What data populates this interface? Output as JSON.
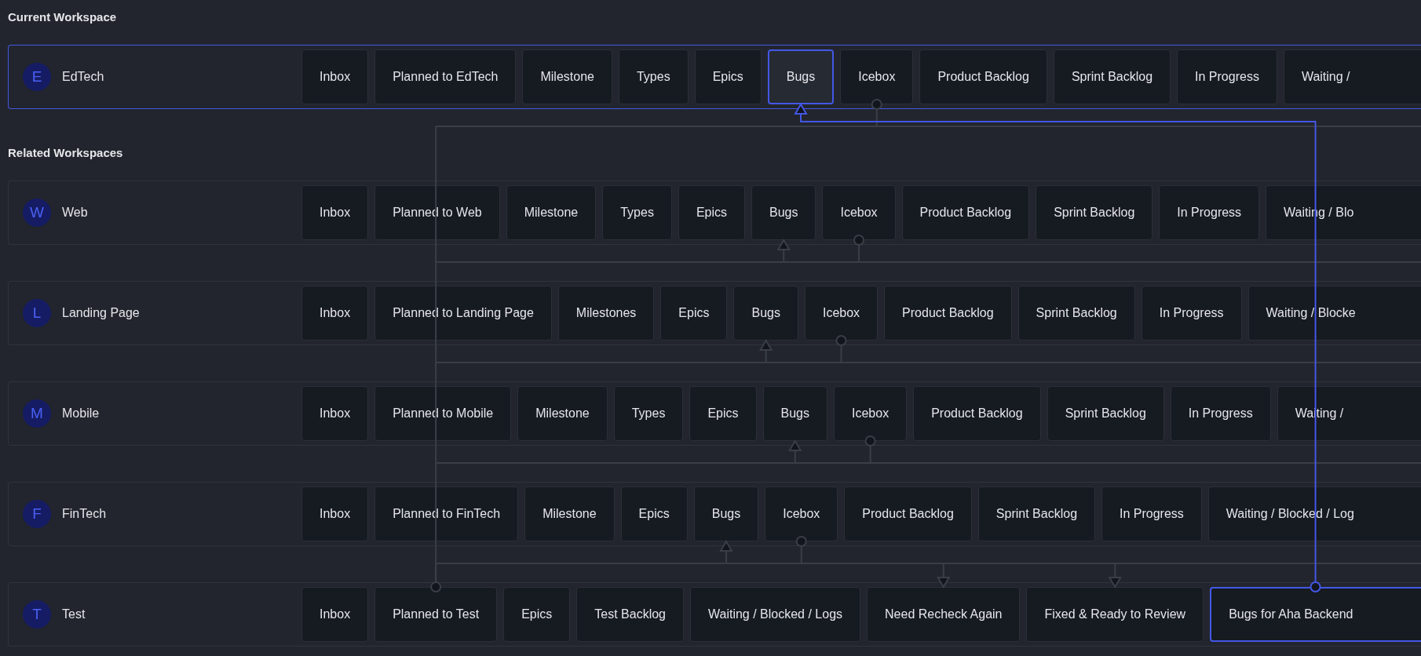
{
  "sections": [
    {
      "title": "Current Workspace",
      "workspaces": [
        {
          "initial": "E",
          "name": "EdTech",
          "selected": true,
          "lanes": [
            {
              "label": "Inbox",
              "selected": false,
              "kind": "plain"
            },
            {
              "label": "Planned to EdTech",
              "selected": false,
              "kind": "plain"
            },
            {
              "label": "Milestone",
              "selected": false,
              "kind": "plain"
            },
            {
              "label": "Types",
              "selected": false,
              "kind": "plain"
            },
            {
              "label": "Epics",
              "selected": false,
              "kind": "plain"
            },
            {
              "label": "Bugs",
              "selected": true,
              "kind": "target"
            },
            {
              "label": "Icebox",
              "selected": false,
              "kind": "source"
            },
            {
              "label": "Product Backlog",
              "selected": false,
              "kind": "plain"
            },
            {
              "label": "Sprint Backlog",
              "selected": false,
              "kind": "plain"
            },
            {
              "label": "In Progress",
              "selected": false,
              "kind": "plain"
            },
            {
              "label": "Waiting /",
              "selected": false,
              "kind": "plain"
            }
          ]
        }
      ]
    },
    {
      "title": "Related Workspaces",
      "workspaces": [
        {
          "initial": "W",
          "name": "Web",
          "selected": false,
          "lanes": [
            {
              "label": "Inbox",
              "selected": false,
              "kind": "plain"
            },
            {
              "label": "Planned to Web",
              "selected": false,
              "kind": "plain"
            },
            {
              "label": "Milestone",
              "selected": false,
              "kind": "plain"
            },
            {
              "label": "Types",
              "selected": false,
              "kind": "plain"
            },
            {
              "label": "Epics",
              "selected": false,
              "kind": "plain"
            },
            {
              "label": "Bugs",
              "selected": false,
              "kind": "target"
            },
            {
              "label": "Icebox",
              "selected": false,
              "kind": "source"
            },
            {
              "label": "Product Backlog",
              "selected": false,
              "kind": "plain"
            },
            {
              "label": "Sprint Backlog",
              "selected": false,
              "kind": "plain"
            },
            {
              "label": "In Progress",
              "selected": false,
              "kind": "plain"
            },
            {
              "label": "Waiting / Blo",
              "selected": false,
              "kind": "plain"
            }
          ]
        },
        {
          "initial": "L",
          "name": "Landing Page",
          "selected": false,
          "lanes": [
            {
              "label": "Inbox",
              "selected": false,
              "kind": "plain"
            },
            {
              "label": "Planned to Landing Page",
              "selected": false,
              "kind": "plain"
            },
            {
              "label": "Milestones",
              "selected": false,
              "kind": "plain"
            },
            {
              "label": "Epics",
              "selected": false,
              "kind": "plain"
            },
            {
              "label": "Bugs",
              "selected": false,
              "kind": "target"
            },
            {
              "label": "Icebox",
              "selected": false,
              "kind": "source"
            },
            {
              "label": "Product Backlog",
              "selected": false,
              "kind": "plain"
            },
            {
              "label": "Sprint Backlog",
              "selected": false,
              "kind": "plain"
            },
            {
              "label": "In Progress",
              "selected": false,
              "kind": "plain"
            },
            {
              "label": "Waiting / Blocke",
              "selected": false,
              "kind": "plain"
            }
          ]
        },
        {
          "initial": "M",
          "name": "Mobile",
          "selected": false,
          "lanes": [
            {
              "label": "Inbox",
              "selected": false,
              "kind": "plain"
            },
            {
              "label": "Planned to Mobile",
              "selected": false,
              "kind": "plain"
            },
            {
              "label": "Milestone",
              "selected": false,
              "kind": "plain"
            },
            {
              "label": "Types",
              "selected": false,
              "kind": "plain"
            },
            {
              "label": "Epics",
              "selected": false,
              "kind": "plain"
            },
            {
              "label": "Bugs",
              "selected": false,
              "kind": "target"
            },
            {
              "label": "Icebox",
              "selected": false,
              "kind": "source"
            },
            {
              "label": "Product Backlog",
              "selected": false,
              "kind": "plain"
            },
            {
              "label": "Sprint Backlog",
              "selected": false,
              "kind": "plain"
            },
            {
              "label": "In Progress",
              "selected": false,
              "kind": "plain"
            },
            {
              "label": "Waiting /",
              "selected": false,
              "kind": "plain"
            }
          ]
        },
        {
          "initial": "F",
          "name": "FinTech",
          "selected": false,
          "lanes": [
            {
              "label": "Inbox",
              "selected": false,
              "kind": "plain"
            },
            {
              "label": "Planned to FinTech",
              "selected": false,
              "kind": "plain"
            },
            {
              "label": "Milestone",
              "selected": false,
              "kind": "plain"
            },
            {
              "label": "Epics",
              "selected": false,
              "kind": "plain"
            },
            {
              "label": "Bugs",
              "selected": false,
              "kind": "target"
            },
            {
              "label": "Icebox",
              "selected": false,
              "kind": "source"
            },
            {
              "label": "Product Backlog",
              "selected": false,
              "kind": "plain"
            },
            {
              "label": "Sprint Backlog",
              "selected": false,
              "kind": "plain"
            },
            {
              "label": "In Progress",
              "selected": false,
              "kind": "plain"
            },
            {
              "label": "Waiting / Blocked / Log",
              "selected": false,
              "kind": "plain"
            }
          ]
        },
        {
          "initial": "T",
          "name": "Test",
          "selected": false,
          "lanes": [
            {
              "label": "Inbox",
              "selected": false,
              "kind": "plain"
            },
            {
              "label": "Planned to Test",
              "selected": false,
              "kind": "source"
            },
            {
              "label": "Epics",
              "selected": false,
              "kind": "plain"
            },
            {
              "label": "Test Backlog",
              "selected": false,
              "kind": "plain"
            },
            {
              "label": "Waiting / Blocked / Logs",
              "selected": false,
              "kind": "plain"
            },
            {
              "label": "Need Recheck Again",
              "selected": false,
              "kind": "target"
            },
            {
              "label": "Fixed & Ready to Review",
              "selected": false,
              "kind": "target"
            },
            {
              "label": "Bugs for Aha Backend",
              "selected": true,
              "kind": "source"
            }
          ]
        }
      ]
    }
  ]
}
